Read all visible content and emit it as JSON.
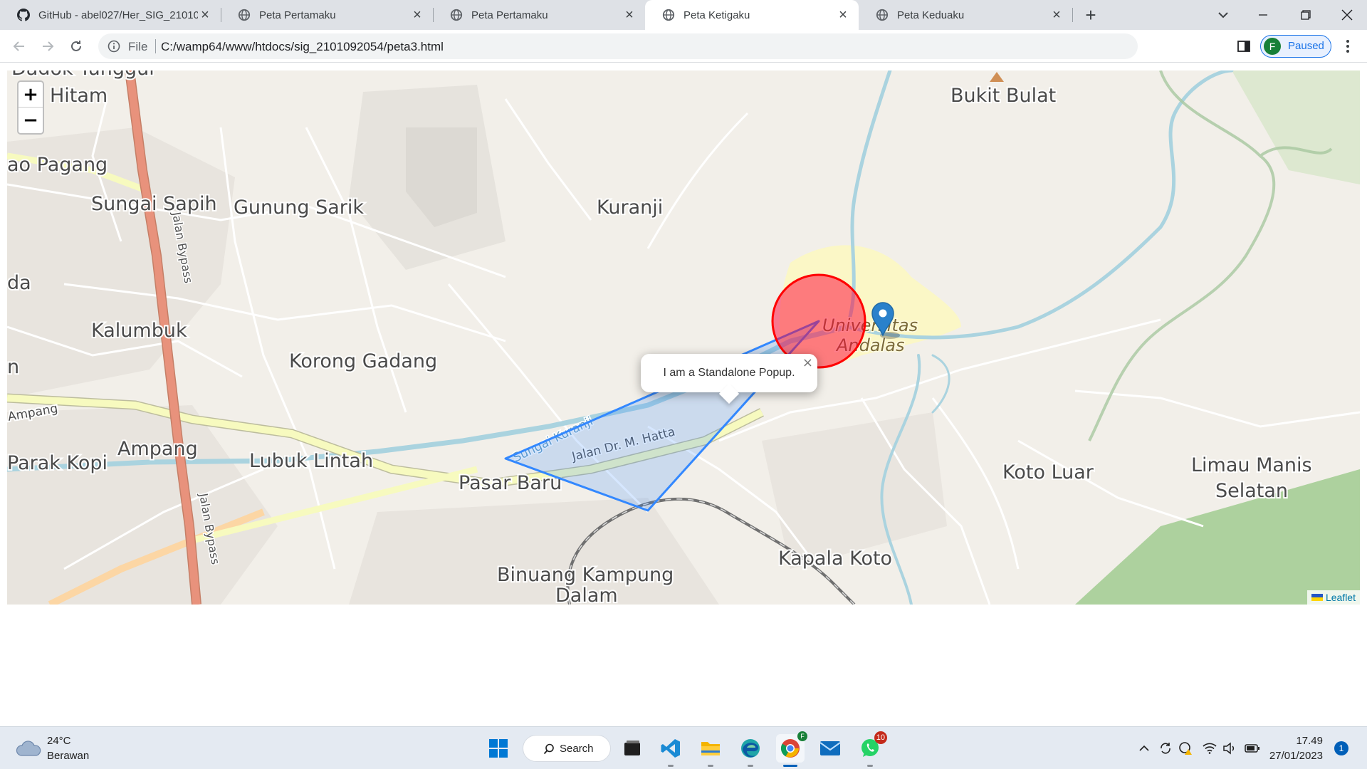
{
  "browser": {
    "tabs": [
      {
        "title": "GitHub - abel027/Her_SIG_21010",
        "icon": "github-icon"
      },
      {
        "title": "Peta Pertamaku",
        "icon": "globe-icon"
      },
      {
        "title": "Peta Pertamaku",
        "icon": "globe-icon"
      },
      {
        "title": "Peta Ketigaku",
        "icon": "globe-icon",
        "active": true
      },
      {
        "title": "Peta Keduaku",
        "icon": "globe-icon"
      }
    ],
    "new_tab_label": "+",
    "address": {
      "scheme_label": "File",
      "url": "C:/wamp64/www/htdocs/sig_2101092054/peta3.html"
    },
    "profile": {
      "initial": "F",
      "status": "Paused"
    }
  },
  "map": {
    "zoom_in_label": "+",
    "zoom_out_label": "−",
    "popup": {
      "text": "I am a Standalone Popup.",
      "close_label": "×"
    },
    "attribution": "Leaflet",
    "place_labels": [
      "Dadok Tunggul",
      "Hitam",
      "ao Pagang",
      "Sungai Sapih",
      "Gunung Sarik",
      "Kuranji",
      "Bukit Bulat",
      "da",
      "Kalumbuk",
      "Korong Gadang",
      "n",
      "Ampang",
      "Ampang",
      "Parak Kopi",
      "Lubuk Lintah",
      "Pasar Baru",
      "Universitas",
      "Andalas",
      "Koto Luar",
      "Limau Manis",
      "Selatan",
      "Kapala Koto",
      "Binuang Kampung",
      "Dalam",
      "Jalan Bypass",
      "Jalan Bypass",
      "Jalan Dr. M. Hatta",
      "Sungai Kuranji"
    ],
    "colors": {
      "circle_fill": "#f03",
      "circle_stroke": "#ff0000",
      "polygon_stroke": "#3388ff",
      "marker": "#2a81cb",
      "motorway": "#e8927c",
      "primary": "#f7fabf",
      "water": "#aad3df",
      "park": "#add19e"
    }
  },
  "taskbar": {
    "weather": {
      "temp": "24°C",
      "desc": "Berawan"
    },
    "search_label": "Search",
    "apps": [
      {
        "name": "windows-start"
      },
      {
        "name": "task-view"
      },
      {
        "name": "vs-code"
      },
      {
        "name": "file-explorer"
      },
      {
        "name": "edge"
      },
      {
        "name": "chrome"
      },
      {
        "name": "mail"
      },
      {
        "name": "whatsapp",
        "badge": "10"
      }
    ],
    "clock": {
      "time": "17.49",
      "date": "27/01/2023"
    },
    "notifications": "1"
  }
}
